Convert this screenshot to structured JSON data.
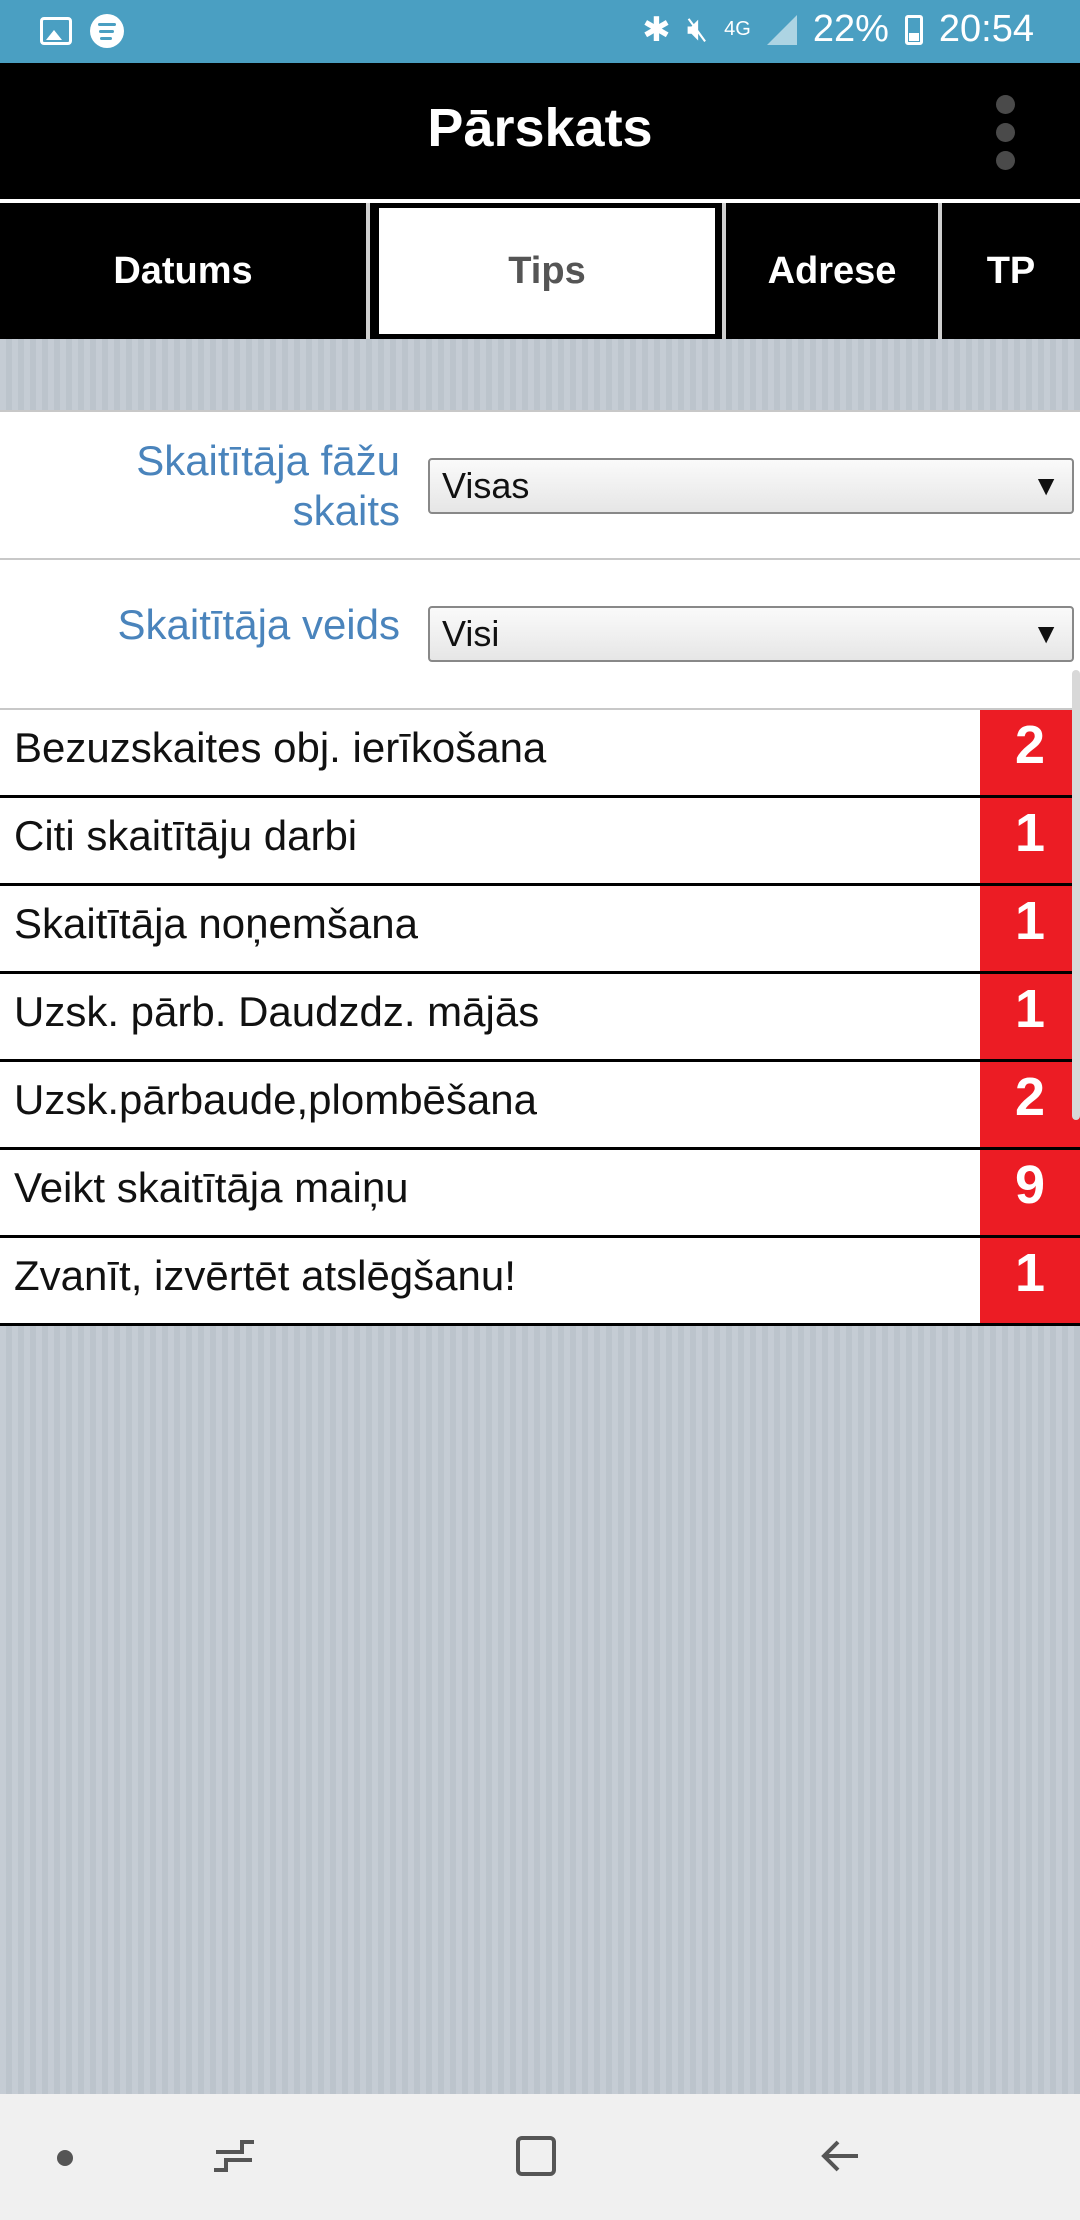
{
  "status_bar": {
    "battery": "22%",
    "time": "20:54",
    "network": "4G",
    "icons": [
      "gallery-icon",
      "spotify-icon",
      "bluetooth-icon",
      "mute-icon",
      "signal-icon",
      "battery-icon"
    ]
  },
  "app_bar": {
    "title": "Pārskats",
    "menu_icon": "more-vert-icon"
  },
  "tabs": [
    {
      "label": "Datums",
      "active": false
    },
    {
      "label": "Tips",
      "active": true
    },
    {
      "label": "Adrese",
      "active": false
    },
    {
      "label": "TP",
      "active": false
    }
  ],
  "filters": {
    "phases": {
      "label_line1": "Skaitītāja fāžu",
      "label_line2": "skaits",
      "value": "Visas"
    },
    "type": {
      "label": "Skaitītāja veids",
      "value": "Visi"
    },
    "arrow": "▼"
  },
  "items": [
    {
      "label": "Bezuzskaites obj. ierīkošana",
      "count": "2"
    },
    {
      "label": "Citi skaitītāju darbi",
      "count": "1"
    },
    {
      "label": "Skaitītāja noņemšana",
      "count": "1"
    },
    {
      "label": "Uzsk. pārb. Daudzdz. mājās",
      "count": "1"
    },
    {
      "label": "Uzsk.pārbaude,plombēšana",
      "count": "2"
    },
    {
      "label": "Veikt skaitītāja maiņu",
      "count": "9"
    },
    {
      "label": "Zvanīt, izvērtēt atslēgšanu!",
      "count": "1"
    }
  ],
  "colors": {
    "status_bar": "#4a9fc2",
    "app_bar": "#000000",
    "label_blue": "#4a84bc",
    "badge_red": "#ec1c24",
    "background": "#c5ccd4"
  }
}
